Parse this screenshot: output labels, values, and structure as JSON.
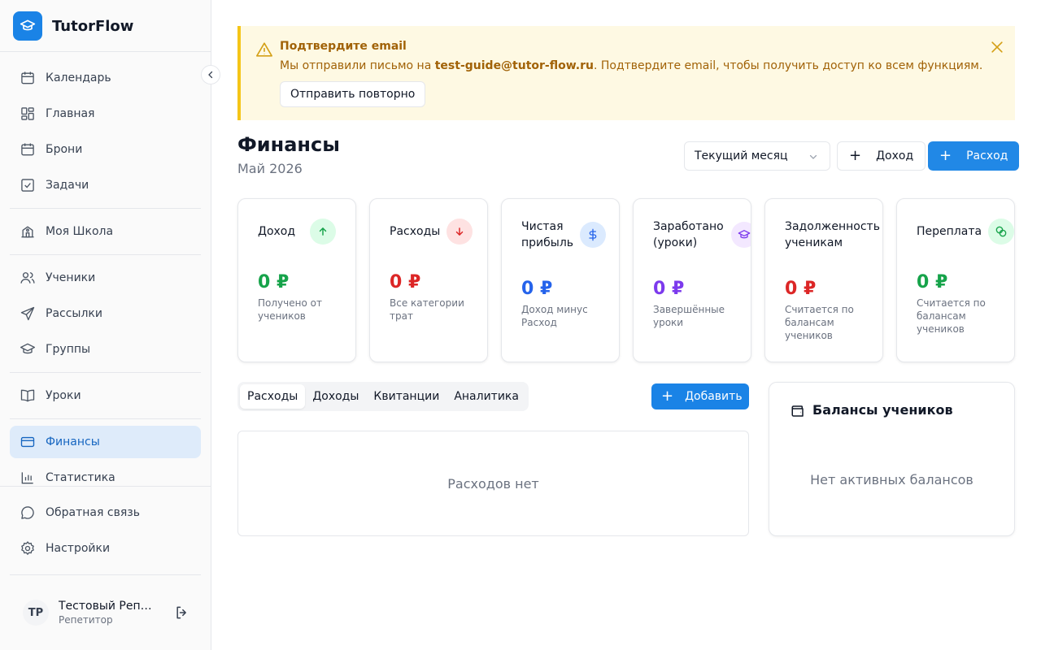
{
  "app": {
    "name": "TutorFlow"
  },
  "sidebar": {
    "items": [
      {
        "label": "Календарь",
        "icon": "calendar-icon"
      },
      {
        "label": "Главная",
        "icon": "dashboard-icon"
      },
      {
        "label": "Брони",
        "icon": "calendar-icon"
      },
      {
        "label": "Задачи",
        "icon": "checkbox-icon"
      },
      {
        "label": "Моя Школа",
        "icon": "school-icon"
      },
      {
        "label": "Ученики",
        "icon": "users-icon"
      },
      {
        "label": "Рассылки",
        "icon": "send-icon"
      },
      {
        "label": "Группы",
        "icon": "graduation-cap-icon"
      },
      {
        "label": "Уроки",
        "icon": "book-icon"
      },
      {
        "label": "Финансы",
        "icon": "credit-card-icon",
        "active": true
      },
      {
        "label": "Статистика",
        "icon": "bar-chart-icon"
      }
    ],
    "footer_items": [
      {
        "label": "Обратная связь",
        "icon": "message-icon"
      },
      {
        "label": "Настройки",
        "icon": "gear-icon"
      }
    ],
    "user": {
      "initials": "TP",
      "name": "Тестовый Репетитор",
      "role": "Репетитор"
    }
  },
  "alert": {
    "title": "Подтвердите email",
    "message_prefix": "Мы отправили письмо на ",
    "email": "test-guide@tutor-flow.ru",
    "message_suffix": ". Подтвердите email, чтобы получить доступ ко всем функциям.",
    "resend_label": "Отправить повторно"
  },
  "header": {
    "title": "Финансы",
    "subtitle": "Май 2026",
    "period": "Текущий месяц",
    "income_button": "Доход",
    "expense_button": "Расход"
  },
  "cards": [
    {
      "label": "Доход",
      "value": "0 ₽",
      "desc": "Получено от учеников",
      "color": "#16a34a",
      "icon_bg": "#dcfce7",
      "icon": "arrow-up-icon"
    },
    {
      "label": "Расходы",
      "value": "0 ₽",
      "desc": "Все категории трат",
      "color": "#dc2626",
      "icon_bg": "#fee2e2",
      "icon": "arrow-down-icon"
    },
    {
      "label": "Чистая прибыль",
      "value": "0 ₽",
      "desc": "Доход минус Расход",
      "color": "#2563eb",
      "icon_bg": "#dbeafe",
      "icon": "dollar-icon"
    },
    {
      "label": "Заработано (уроки)",
      "value": "0 ₽",
      "desc": "Завершённые уроки",
      "color": "#7c3aed",
      "icon_bg": "#f3e8ff",
      "icon": "graduation-cap-icon"
    },
    {
      "label": "Задолженность ученикам",
      "value": "0 ₽",
      "desc": "Считается по балансам учеников",
      "color": "#dc2626",
      "icon_bg": "#fee2e2",
      "icon": "alert-circle-icon"
    },
    {
      "label": "Переплата",
      "value": "0 ₽",
      "desc": "Считается по балансам учеников",
      "color": "#16a34a",
      "icon_bg": "#dcfce7",
      "icon": "coins-icon"
    }
  ],
  "tabs": [
    "Расходы",
    "Доходы",
    "Квитанции",
    "Аналитика"
  ],
  "add_button": "Добавить",
  "expenses_empty": "Расходов нет",
  "balances": {
    "title": "Балансы учеников",
    "empty": "Нет активных балансов"
  }
}
